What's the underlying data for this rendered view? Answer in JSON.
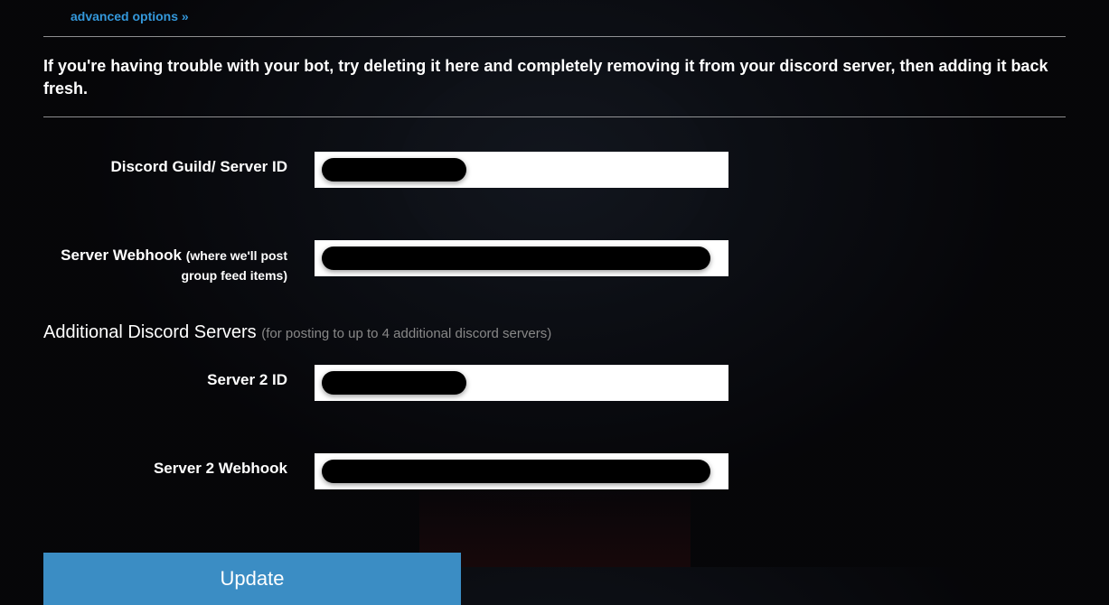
{
  "links": {
    "advanced_options": "advanced options »"
  },
  "help_text": "If you're having trouble with your bot, try deleting it here and completely removing it from your discord server, then adding it back fresh.",
  "fields": {
    "guild_id": {
      "label": "Discord Guild/ Server ID"
    },
    "webhook": {
      "label": "Server Webhook ",
      "sublabel": "(where we'll post group feed items)"
    },
    "server2_id": {
      "label": "Server 2 ID"
    },
    "server2_webhook": {
      "label": "Server 2 Webhook"
    }
  },
  "sections": {
    "additional": {
      "title": "Additional Discord Servers ",
      "hint": "(for posting to up to 4 additional discord servers)"
    }
  },
  "buttons": {
    "update": "Update"
  }
}
